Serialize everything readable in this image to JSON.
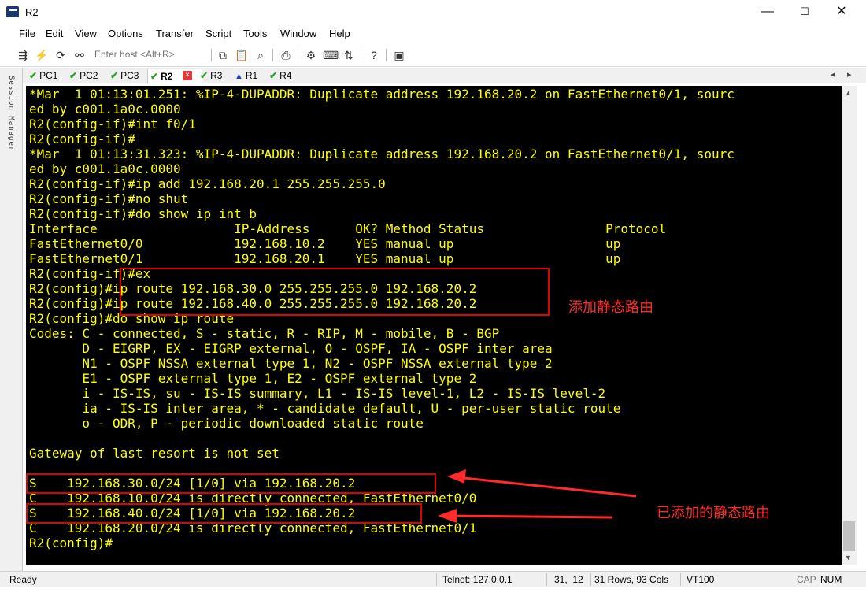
{
  "window": {
    "title": "R2",
    "minimize": "—",
    "maximize": "☐",
    "close": "✕"
  },
  "menu": [
    "File",
    "Edit",
    "View",
    "Options",
    "Transfer",
    "Script",
    "Tools",
    "Window",
    "Help"
  ],
  "toolbar": {
    "host_placeholder": "Enter host <Alt+R>"
  },
  "session_manager": {
    "label": "Session Manager"
  },
  "tabs": [
    {
      "label": "PC1",
      "status": "connected"
    },
    {
      "label": "PC2",
      "status": "connected"
    },
    {
      "label": "PC3",
      "status": "connected"
    },
    {
      "label": "R2",
      "status": "active"
    },
    {
      "label": "R3",
      "status": "connected"
    },
    {
      "label": "R1",
      "status": "warning"
    },
    {
      "label": "R4",
      "status": "connected"
    }
  ],
  "terminal": {
    "lines": [
      "*Mar  1 01:13:01.251: %IP-4-DUPADDR: Duplicate address 192.168.20.2 on FastEthernet0/1, sourc",
      "ed by c001.1a0c.0000",
      "R2(config-if)#int f0/1",
      "R2(config-if)#",
      "*Mar  1 01:13:31.323: %IP-4-DUPADDR: Duplicate address 192.168.20.2 on FastEthernet0/1, sourc",
      "ed by c001.1a0c.0000",
      "R2(config-if)#ip add 192.168.20.1 255.255.255.0",
      "R2(config-if)#no shut",
      "R2(config-if)#do show ip int b",
      "Interface                  IP-Address      OK? Method Status                Protocol",
      "FastEthernet0/0            192.168.10.2    YES manual up                    up",
      "FastEthernet0/1            192.168.20.1    YES manual up                    up",
      "R2(config-if)#ex",
      "R2(config)#ip route 192.168.30.0 255.255.255.0 192.168.20.2",
      "R2(config)#ip route 192.168.40.0 255.255.255.0 192.168.20.2",
      "R2(config)#do show ip route",
      "Codes: C - connected, S - static, R - RIP, M - mobile, B - BGP",
      "       D - EIGRP, EX - EIGRP external, O - OSPF, IA - OSPF inter area",
      "       N1 - OSPF NSSA external type 1, N2 - OSPF NSSA external type 2",
      "       E1 - OSPF external type 1, E2 - OSPF external type 2",
      "       i - IS-IS, su - IS-IS summary, L1 - IS-IS level-1, L2 - IS-IS level-2",
      "       ia - IS-IS inter area, * - candidate default, U - per-user static route",
      "       o - ODR, P - periodic downloaded static route",
      "",
      "Gateway of last resort is not set",
      "",
      "S    192.168.30.0/24 [1/0] via 192.168.20.2",
      "C    192.168.10.0/24 is directly connected, FastEthernet0/0",
      "S    192.168.40.0/24 [1/0] via 192.168.20.2",
      "C    192.168.20.0/24 is directly connected, FastEthernet0/1",
      "R2(config)#"
    ]
  },
  "annotations": {
    "add_static_route": "添加静态路由",
    "added_static_route": "已添加的静态路由"
  },
  "status": {
    "ready": "Ready",
    "telnet": "Telnet: 127.0.0.1",
    "cursor": "31,  12",
    "size": "31 Rows, 93 Cols",
    "emulation": "VT100",
    "cap": "CAP",
    "num": "NUM"
  },
  "colors": {
    "terminal_bg": "#000000",
    "terminal_fg": "#ffff00",
    "annotation": "#ff2a2a"
  }
}
